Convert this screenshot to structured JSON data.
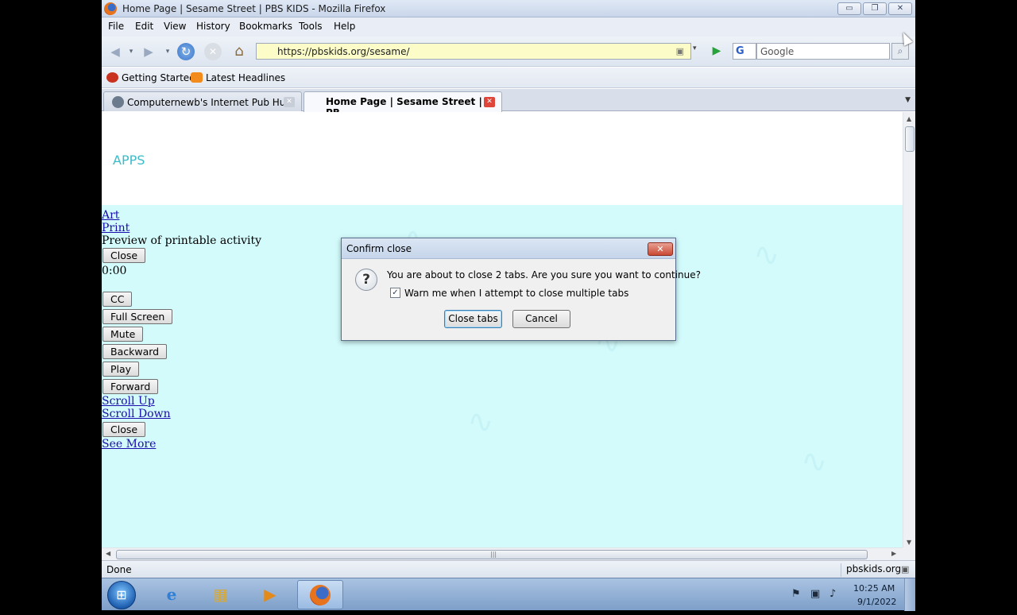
{
  "window": {
    "title": "Home Page | Sesame Street | PBS KIDS - Mozilla Firefox",
    "min_glyph": "▭",
    "max_glyph": "❐",
    "close_glyph": "✕"
  },
  "menu": [
    "File",
    "Edit",
    "View",
    "History",
    "Bookmarks",
    "Tools",
    "Help"
  ],
  "navbar": {
    "url": "https://pbskids.org/sesame/",
    "search_engine": "G",
    "search_placeholder": "Google"
  },
  "bookmarks": [
    {
      "label": "Getting Started",
      "icon": "firefox-icon"
    },
    {
      "label": "Latest Headlines",
      "icon": "rss-icon"
    }
  ],
  "tabs": [
    {
      "label": "Computernewb's Internet Pub Hub",
      "active": false
    },
    {
      "label": "Home Page | Sesame Street | PB...",
      "active": true
    }
  ],
  "page": {
    "heading": "APPS",
    "art_link": "Art",
    "print_link": "Print",
    "preview_text": "Preview of printable activity",
    "close_1": "Close",
    "time": "0:00",
    "cc": "CC",
    "fullscreen": "Full Screen",
    "mute": "Mute",
    "backward": "Backward",
    "play": "Play",
    "forward": "Forward",
    "scroll_up": "Scroll Up",
    "scroll_down": "Scroll Down",
    "close_2": "Close",
    "see_more": "See More"
  },
  "status": {
    "text": "Done",
    "domain": "pbskids.org"
  },
  "taskbar": {
    "time": "10:25 AM",
    "date": "9/1/2022"
  },
  "dialog": {
    "title": "Confirm close",
    "message": "You are about to close 2 tabs. Are you sure you want to continue?",
    "checkbox_label": "Warn me when I attempt to close multiple tabs",
    "checkbox_checked": true,
    "close_tabs_label": "Close tabs",
    "cancel_label": "Cancel"
  },
  "colors": {
    "page_background": "#d3fbfc",
    "apps_heading": "#3bbcc8",
    "link": "#1a0dab"
  }
}
